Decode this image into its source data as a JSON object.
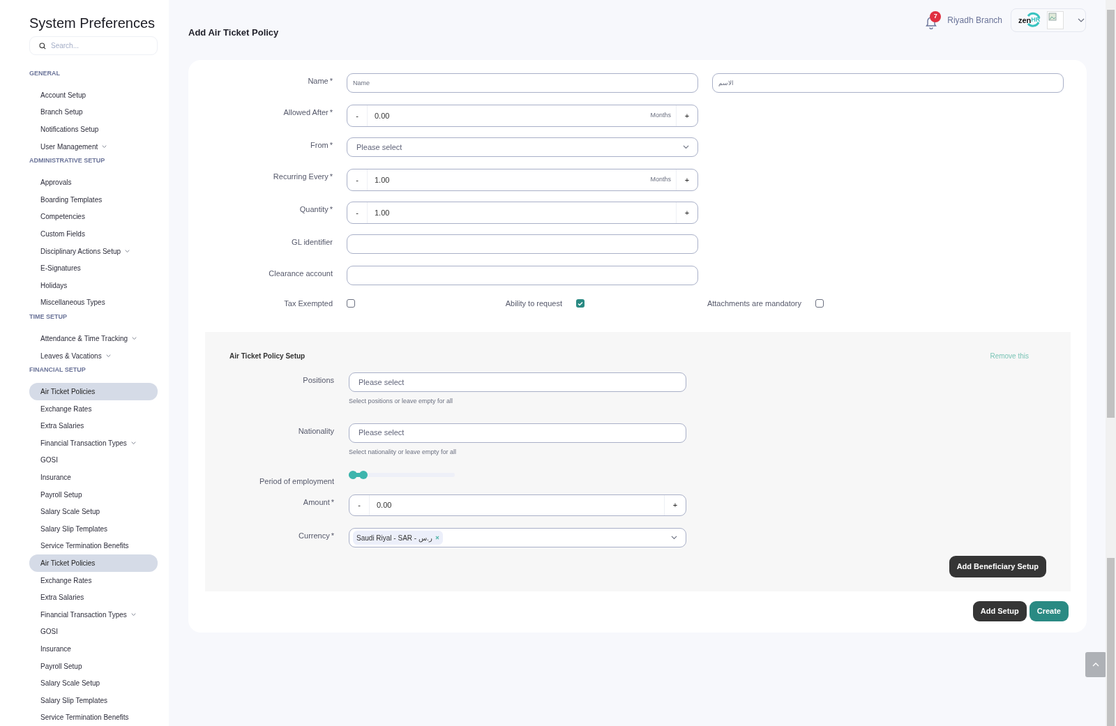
{
  "sidebar": {
    "title": "System Preferences",
    "search_placeholder": "Search...",
    "sections": [
      {
        "heading": "GENERAL",
        "items": [
          {
            "label": "Account Setup",
            "selected": false,
            "has_submenu": false
          },
          {
            "label": "Branch Setup",
            "selected": false,
            "has_submenu": false
          },
          {
            "label": "Notifications Setup",
            "selected": false,
            "has_submenu": false
          },
          {
            "label": "User Management",
            "selected": false,
            "has_submenu": true
          }
        ]
      },
      {
        "heading": "ADMINISTRATIVE SETUP",
        "items": [
          {
            "label": "Approvals",
            "selected": false,
            "has_submenu": false
          },
          {
            "label": "Boarding Templates",
            "selected": false,
            "has_submenu": false
          },
          {
            "label": "Competencies",
            "selected": false,
            "has_submenu": false
          },
          {
            "label": "Custom Fields",
            "selected": false,
            "has_submenu": false
          },
          {
            "label": "Disciplinary Actions Setup",
            "selected": false,
            "has_submenu": true
          },
          {
            "label": "E-Signatures",
            "selected": false,
            "has_submenu": false
          },
          {
            "label": "Holidays",
            "selected": false,
            "has_submenu": false
          },
          {
            "label": "Miscellaneous Types",
            "selected": false,
            "has_submenu": false
          }
        ]
      },
      {
        "heading": "TIME SETUP",
        "items": [
          {
            "label": "Attendance & Time Tracking",
            "selected": false,
            "has_submenu": true
          },
          {
            "label": "Leaves & Vacations",
            "selected": false,
            "has_submenu": true
          }
        ]
      },
      {
        "heading": "FINANCIAL SETUP",
        "items": [
          {
            "label": "Air Ticket Policies",
            "selected": true,
            "has_submenu": false
          },
          {
            "label": "Exchange Rates",
            "selected": false,
            "has_submenu": false
          },
          {
            "label": "Extra Salaries",
            "selected": false,
            "has_submenu": false
          },
          {
            "label": "Financial Transaction Types",
            "selected": false,
            "has_submenu": true
          },
          {
            "label": "GOSI",
            "selected": false,
            "has_submenu": false
          },
          {
            "label": "Insurance",
            "selected": false,
            "has_submenu": false
          },
          {
            "label": "Payroll Setup",
            "selected": false,
            "has_submenu": false
          },
          {
            "label": "Salary Scale Setup",
            "selected": false,
            "has_submenu": false
          },
          {
            "label": "Salary Slip Templates",
            "selected": false,
            "has_submenu": false
          },
          {
            "label": "Service Termination Benefits",
            "selected": false,
            "has_submenu": false
          },
          {
            "label": "Air Ticket Policies",
            "selected": true,
            "has_submenu": false
          },
          {
            "label": "Exchange Rates",
            "selected": false,
            "has_submenu": false
          },
          {
            "label": "Extra Salaries",
            "selected": false,
            "has_submenu": false
          },
          {
            "label": "Financial Transaction Types",
            "selected": false,
            "has_submenu": true
          },
          {
            "label": "GOSI",
            "selected": false,
            "has_submenu": false
          },
          {
            "label": "Insurance",
            "selected": false,
            "has_submenu": false
          },
          {
            "label": "Payroll Setup",
            "selected": false,
            "has_submenu": false
          },
          {
            "label": "Salary Scale Setup",
            "selected": false,
            "has_submenu": false
          },
          {
            "label": "Salary Slip Templates",
            "selected": false,
            "has_submenu": false
          },
          {
            "label": "Service Termination Benefits",
            "selected": false,
            "has_submenu": false
          }
        ]
      }
    ]
  },
  "header": {
    "title": "Add Air Ticket Policy",
    "notification_count": "7",
    "branch": "Riyadh Branch",
    "logo": {
      "part_1": "zen",
      "part_2": "HR"
    }
  },
  "form": {
    "fields": [
      {
        "kind": "text",
        "label": "Name",
        "required_mark": "*",
        "inputs": [
          {
            "placeholder": "Name"
          },
          {
            "placeholder": "الاسم"
          }
        ]
      },
      {
        "kind": "stepper",
        "label": "Allowed After",
        "required_mark": "*",
        "minus": "-",
        "value": "0.00",
        "unit": "Months",
        "plus": "+"
      },
      {
        "kind": "select",
        "label": "From",
        "required_mark": "*",
        "placeholder": "Please select"
      },
      {
        "kind": "stepper",
        "label": "Recurring Every",
        "required_mark": "*",
        "minus": "-",
        "value": "1.00",
        "unit": "Months",
        "plus": "+"
      },
      {
        "kind": "stepper",
        "label": "Quantity",
        "required_mark": "*",
        "minus": "-",
        "value": "1.00",
        "plus": "+"
      },
      {
        "kind": "text",
        "label": "GL identifier"
      },
      {
        "kind": "text",
        "label": "Clearance account"
      }
    ],
    "checkboxes": [
      {
        "label": "Tax Exempted",
        "checked": false
      },
      {
        "label": "Ability to request",
        "checked": true
      },
      {
        "label": "Attachments are mandatory",
        "checked": false
      }
    ]
  },
  "setup": {
    "title": "Air Ticket Policy Setup",
    "remove_link": "Remove this",
    "fields": [
      {
        "kind": "select",
        "label": "Positions",
        "placeholder": "Please select",
        "hint": "Select positions or leave empty for all"
      },
      {
        "kind": "select",
        "label": "Nationality",
        "placeholder": "Please select",
        "hint": "Select nationality or leave empty for all"
      },
      {
        "kind": "range",
        "label": "Period of employment",
        "level": 0.1
      },
      {
        "kind": "stepper",
        "label": "Amount",
        "required_mark": "*",
        "minus": "-",
        "value": "0.00",
        "plus": "+"
      },
      {
        "kind": "tags",
        "label": "Currency",
        "required_mark": "*",
        "tags": [
          "Saudi Riyal - SAR - ر.س"
        ]
      }
    ],
    "add_beneficiary_button": "Add Beneficiary Setup"
  },
  "buttons": [
    "Add Setup",
    "Create"
  ]
}
